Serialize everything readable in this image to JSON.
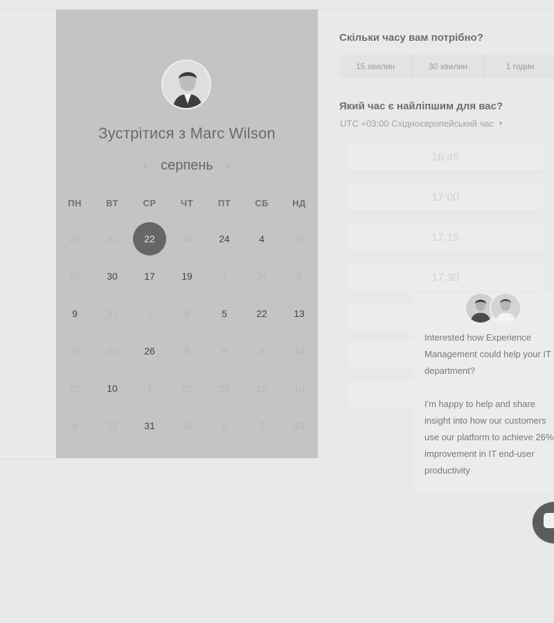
{
  "calendar": {
    "title": "Зустрітися з Marc Wilson",
    "month": "серпень",
    "weekdays": [
      "ПН",
      "ВТ",
      "СР",
      "ЧТ",
      "ПТ",
      "СБ",
      "НД"
    ],
    "rows": [
      [
        {
          "d": "29",
          "f": true
        },
        {
          "d": "31",
          "f": true
        },
        {
          "d": "22",
          "sel": true
        },
        {
          "d": "30",
          "f": true
        },
        {
          "d": "24"
        },
        {
          "d": "4"
        },
        {
          "d": "28",
          "f": true
        }
      ],
      [
        {
          "d": "23",
          "f": true
        },
        {
          "d": "30"
        },
        {
          "d": "17"
        },
        {
          "d": "19"
        },
        {
          "d": "7",
          "f": true
        },
        {
          "d": "24",
          "f": true
        },
        {
          "d": "8",
          "f": true
        }
      ],
      [
        {
          "d": "9"
        },
        {
          "d": "31",
          "f": true
        },
        {
          "d": "1",
          "f": true
        },
        {
          "d": "9",
          "f": true
        },
        {
          "d": "5"
        },
        {
          "d": "22"
        },
        {
          "d": "13"
        }
      ],
      [
        {
          "d": "15",
          "f": true
        },
        {
          "d": "20",
          "f": true
        },
        {
          "d": "26"
        },
        {
          "d": "8",
          "f": true
        },
        {
          "d": "9",
          "f": true
        },
        {
          "d": "2",
          "f": true
        },
        {
          "d": "14",
          "f": true
        }
      ],
      [
        {
          "d": "20",
          "f": true
        },
        {
          "d": "10"
        },
        {
          "d": "1",
          "f": true
        },
        {
          "d": "22",
          "f": true
        },
        {
          "d": "26",
          "f": true
        },
        {
          "d": "16",
          "f": true
        },
        {
          "d": "10",
          "f": true
        }
      ],
      [
        {
          "d": "4",
          "f": true
        },
        {
          "d": "22",
          "f": true
        },
        {
          "d": "31"
        },
        {
          "d": "16",
          "f": true
        },
        {
          "d": "5",
          "f": true
        },
        {
          "d": "7",
          "f": true
        },
        {
          "d": "23",
          "f": true
        }
      ]
    ]
  },
  "duration": {
    "question": "Скільки часу вам потрібно?",
    "options": [
      "15 хвилин",
      "30 хвилин",
      "1 годин"
    ]
  },
  "time": {
    "question": "Який час є найліпшим для вас?",
    "timezone": "UTC +03:00 Східноєвропейський час",
    "slots": [
      "16:45",
      "17:00",
      "17:15",
      "17:30",
      "",
      "",
      ""
    ]
  },
  "chat": {
    "message1": "Interested how Experience Management could help your IT department?",
    "message2": "I'm happy to help and share insight into how our customers use our platform to achieve 26% improvement in IT end-user productivity"
  },
  "colors": {
    "panel": "#c4c4c4",
    "selected": "#666666",
    "background": "#e9e9e9"
  },
  "icons": {
    "prev": "chevron-left-icon",
    "next": "chevron-right-icon",
    "chat": "chat-bubble-icon"
  }
}
